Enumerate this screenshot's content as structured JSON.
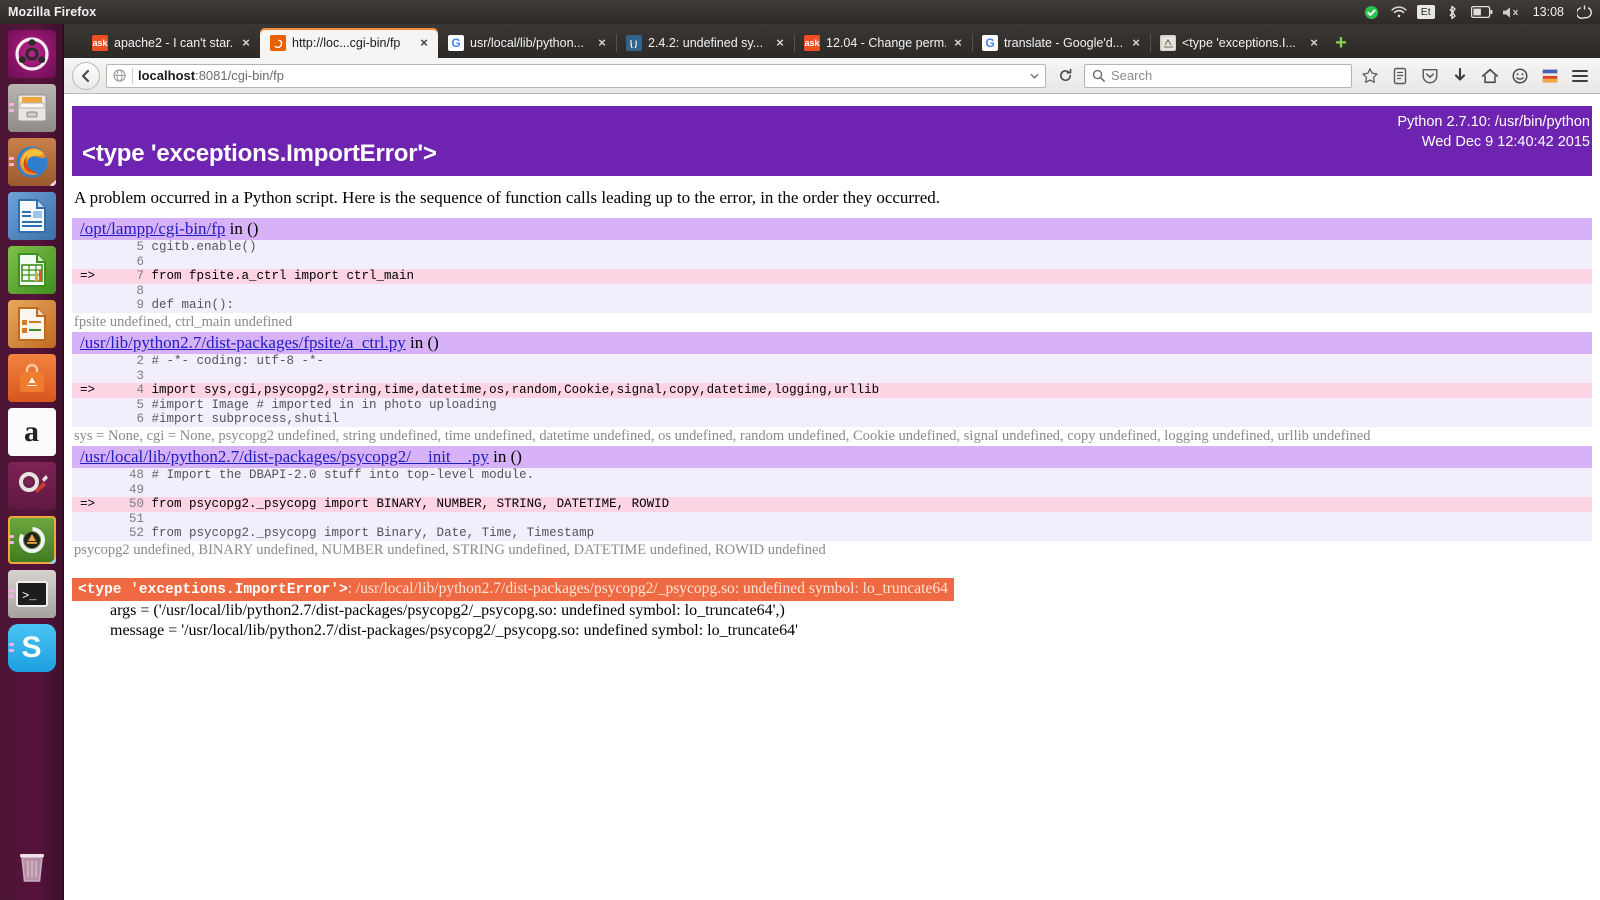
{
  "desktop": {
    "panel_title": "Mozilla Firefox",
    "tray": {
      "update_icon": "green-check-icon",
      "network_icon": "wifi-icon",
      "keyboard_layout": "Et",
      "bluetooth_icon": "bluetooth-icon",
      "battery_icon": "battery-icon",
      "volume_icon": "volume-muted-icon",
      "clock": "13:08",
      "session_icon": "power-gear-icon"
    },
    "launcher": [
      {
        "name": "ubuntu-dash",
        "label": "Dash home",
        "icon": "ubuntu-logo-icon",
        "running": false
      },
      {
        "name": "files",
        "label": "Files",
        "icon": "file-cabinet-icon",
        "running": true
      },
      {
        "name": "firefox",
        "label": "Firefox Web Browser",
        "icon": "firefox-icon",
        "running": true,
        "focused": true
      },
      {
        "name": "libreoffice-writer",
        "label": "LibreOffice Writer",
        "icon": "document-icon",
        "running": false
      },
      {
        "name": "libreoffice-calc",
        "label": "LibreOffice Calc",
        "icon": "spreadsheet-icon",
        "running": false
      },
      {
        "name": "libreoffice-impress",
        "label": "LibreOffice Impress",
        "icon": "presentation-icon",
        "running": false
      },
      {
        "name": "software-center",
        "label": "Ubuntu Software Center",
        "icon": "shopping-bag-icon",
        "running": false
      },
      {
        "name": "amazon",
        "label": "Amazon",
        "icon": "amazon-a-icon",
        "running": false
      },
      {
        "name": "system-settings",
        "label": "System Settings",
        "icon": "gear-wrench-icon",
        "running": false
      },
      {
        "name": "software-updater",
        "label": "Software Updater",
        "icon": "update-refresh-icon",
        "running": true
      },
      {
        "name": "terminal",
        "label": "Terminal",
        "icon": "terminal-icon",
        "running": true
      },
      {
        "name": "skype",
        "label": "Skype",
        "icon": "skype-s-icon",
        "running": true
      }
    ],
    "trash": {
      "label": "Trash",
      "icon": "trash-icon"
    }
  },
  "browser": {
    "tabs": [
      {
        "label": "apache2 - I can't star...",
        "favicon": "ask-ubuntu-icon",
        "active": false
      },
      {
        "label": "http://loc...cgi-bin/fp",
        "favicon": "firefox-page-icon",
        "active": true
      },
      {
        "label": "usr/local/lib/python...",
        "favicon": "google-icon",
        "active": false
      },
      {
        "label": "2.4.2: undefined sy...",
        "favicon": "postgresql-icon",
        "active": false
      },
      {
        "label": "12.04 - Change perm...",
        "favicon": "ask-ubuntu-icon",
        "active": false
      },
      {
        "label": "translate - Google'd...",
        "favicon": "google-icon",
        "active": false
      },
      {
        "label": "<type 'exceptions.I...",
        "favicon": "python-page-icon",
        "active": false
      }
    ],
    "new_tab_label": "+",
    "close_label": "×",
    "toolbar": {
      "back_icon": "back-arrow-icon",
      "url_identity_icon": "globe-icon",
      "url_host": "localhost",
      "url_path": ":8081/cgi-bin/fp",
      "url_full": "localhost:8081/cgi-bin/fp",
      "history_dropdown_icon": "chevron-down-icon",
      "reload_icon": "reload-icon",
      "search_placeholder": "Search",
      "search_icon": "search-icon",
      "bookmark_icon": "star-icon",
      "reader_icon": "reader-list-icon",
      "pocket_icon": "pocket-shield-icon",
      "downloads_icon": "download-arrow-icon",
      "home_icon": "home-icon",
      "sync_icon": "smiley-sync-icon",
      "addon_icon": "colorful-addon-icon",
      "menu_icon": "hamburger-menu-icon"
    }
  },
  "page": {
    "header": {
      "title": "<type 'exceptions.ImportError'>",
      "interpreter": "Python 2.7.10: /usr/bin/python",
      "timestamp": "Wed Dec 9 12:40:42 2015",
      "bg_color": "#6e23b1"
    },
    "intro": "A problem occurred in a Python script. Here is the sequence of function calls leading up to the error, in the order they occurred.",
    "frames": [
      {
        "path": "/opt/lampp/cgi-bin/fp",
        "suffix": " in ()",
        "lines": [
          {
            "arrow": "",
            "num": "5",
            "code": "cgitb.enable()",
            "highlight": false
          },
          {
            "arrow": "",
            "num": "6",
            "code": "",
            "highlight": false
          },
          {
            "arrow": "=>",
            "num": "7",
            "code": "from fpsite.a_ctrl import ctrl_main",
            "highlight": true
          },
          {
            "arrow": "",
            "num": "8",
            "code": "",
            "highlight": false
          },
          {
            "arrow": "",
            "num": "9",
            "code": "def main():",
            "highlight": false
          }
        ],
        "vars": "fpsite undefined, ctrl_main undefined"
      },
      {
        "path": "/usr/lib/python2.7/dist-packages/fpsite/a_ctrl.py",
        "suffix": " in ()",
        "lines": [
          {
            "arrow": "",
            "num": "2",
            "code": "# -*- coding: utf-8 -*-",
            "highlight": false
          },
          {
            "arrow": "",
            "num": "3",
            "code": "",
            "highlight": false
          },
          {
            "arrow": "=>",
            "num": "4",
            "code": "import sys,cgi,psycopg2,string,time,datetime,os,random,Cookie,signal,copy,datetime,logging,urllib",
            "highlight": true
          },
          {
            "arrow": "",
            "num": "5",
            "code": "#import Image # imported in in photo uploading",
            "highlight": false
          },
          {
            "arrow": "",
            "num": "6",
            "code": "#import subprocess,shutil",
            "highlight": false
          }
        ],
        "vars": "sys = None, cgi = None, psycopg2 undefined, string undefined, time undefined, datetime undefined, os undefined, random undefined, Cookie undefined, signal undefined, copy undefined, logging undefined, urllib undefined"
      },
      {
        "path": "/usr/local/lib/python2.7/dist-packages/psycopg2/__init__.py",
        "suffix": " in ()",
        "lines": [
          {
            "arrow": "",
            "num": "48",
            "code": "# Import the DBAPI-2.0 stuff into top-level module.",
            "highlight": false
          },
          {
            "arrow": "",
            "num": "49",
            "code": "",
            "highlight": false
          },
          {
            "arrow": "=>",
            "num": "50",
            "code": "from psycopg2._psycopg import BINARY, NUMBER, STRING, DATETIME, ROWID",
            "highlight": true
          },
          {
            "arrow": "",
            "num": "51",
            "code": "",
            "highlight": false
          },
          {
            "arrow": "",
            "num": "52",
            "code": "from psycopg2._psycopg import Binary, Date, Time, Timestamp",
            "highlight": false
          }
        ],
        "vars": "psycopg2 undefined, BINARY undefined, NUMBER undefined, STRING undefined, DATETIME undefined, ROWID undefined"
      }
    ],
    "exception": {
      "type": "<type 'exceptions.ImportError'>",
      "separator": ": ",
      "message": "/usr/local/lib/python2.7/dist-packages/psycopg2/_psycopg.so: undefined symbol: lo_truncate64",
      "bg_color": "#ef6a42",
      "args": "args = ('/usr/local/lib/python2.7/dist-packages/psycopg2/_psycopg.so: undefined symbol: lo_truncate64',)",
      "message_attr": "message = '/usr/local/lib/python2.7/dist-packages/psycopg2/_psycopg.so: undefined symbol: lo_truncate64'"
    }
  }
}
